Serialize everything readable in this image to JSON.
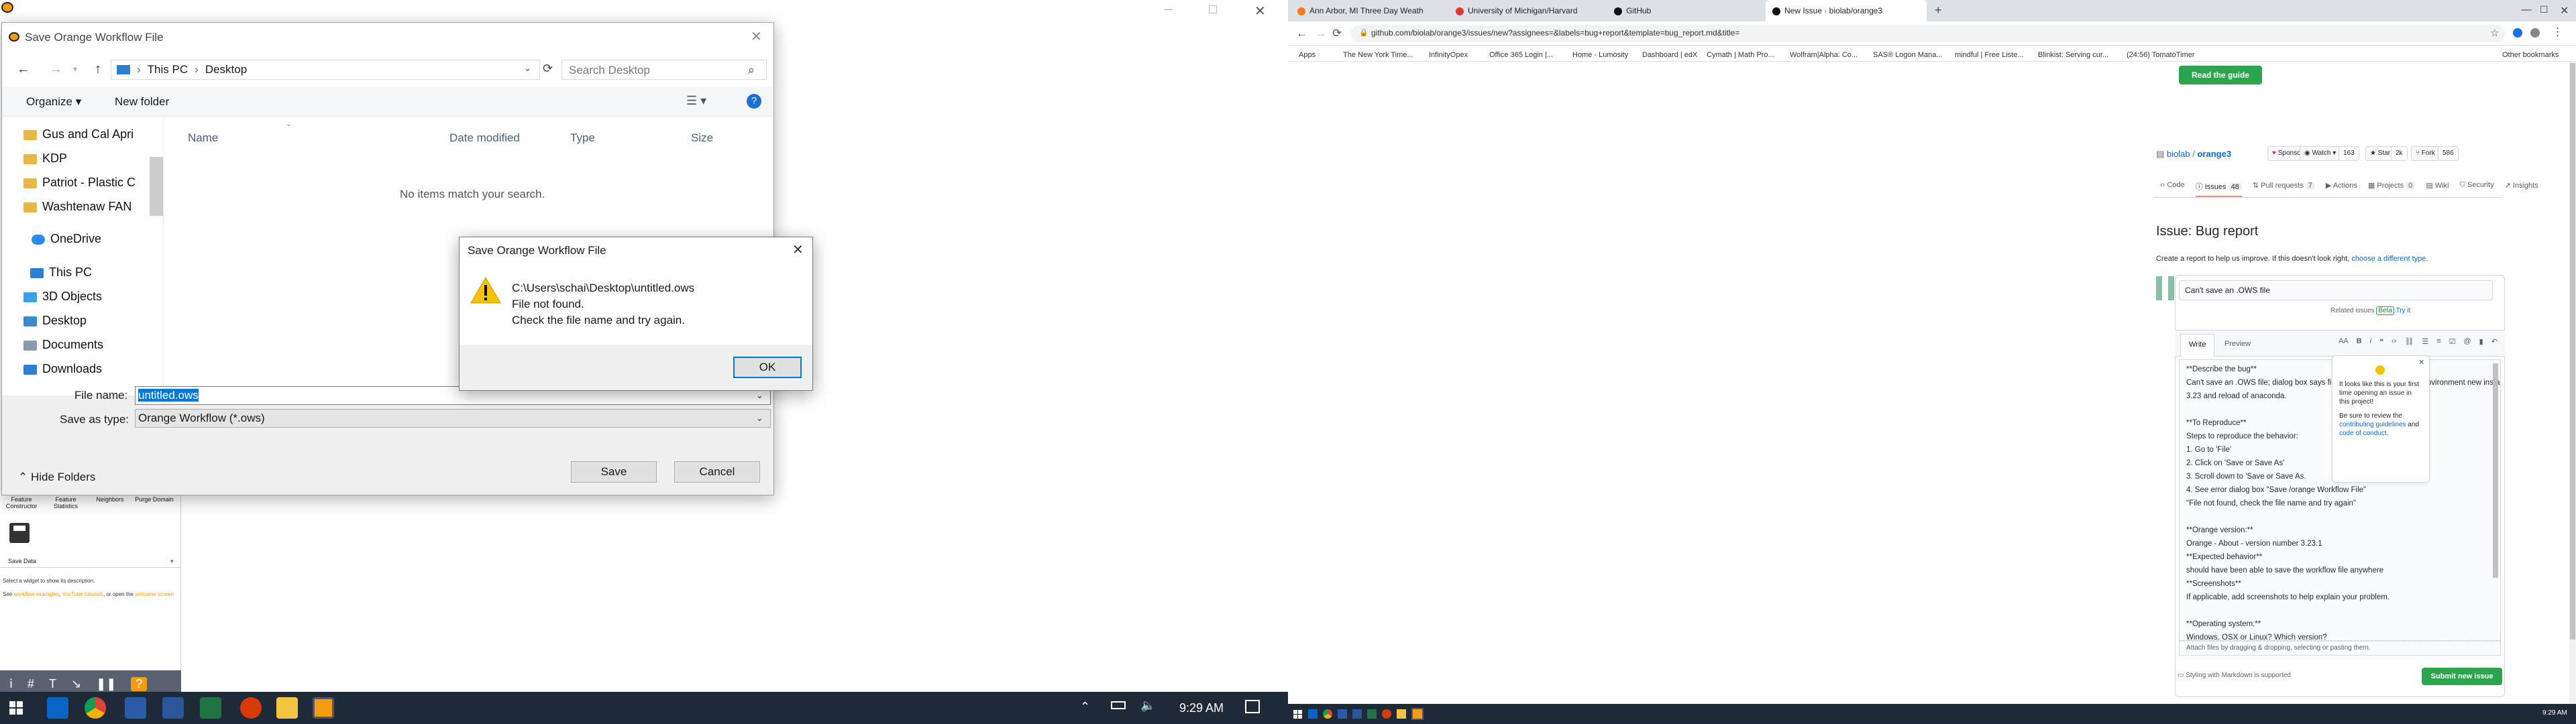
{
  "left": {
    "save_dialog": {
      "title": "Save Orange Workflow File",
      "breadcrumb": [
        "This PC",
        "Desktop"
      ],
      "search_placeholder": "Search Desktop",
      "organize": "Organize",
      "new_folder": "New folder",
      "columns": [
        "Name",
        "Date modified",
        "Type",
        "Size"
      ],
      "empty_text": "No items match your search.",
      "tree": [
        "Gus and Cal Apri",
        "KDP",
        "Patriot - Plastic C",
        "Washtenaw FAN",
        "OneDrive",
        "This PC",
        "3D Objects",
        "Desktop",
        "Documents",
        "Downloads"
      ],
      "file_name_label": "File name:",
      "file_name": "untitled.ows",
      "save_type_label": "Save as type:",
      "save_type": "Orange Workflow (*.ows)",
      "hide_folders": "Hide Folders",
      "save": "Save",
      "cancel": "Cancel"
    },
    "error_dialog": {
      "title": "Save Orange Workflow File",
      "line1": "C:\\Users\\schai\\Desktop\\untitled.ows",
      "line2": "File not found.",
      "line3": "Check the file name and try again.",
      "ok": "OK"
    },
    "orange": {
      "widgets": [
        "Feature Constructor",
        "Feature Statistics",
        "Neighbors",
        "Purge Domain"
      ],
      "save_data": "Save Data",
      "help1": "Select a widget to show its description.",
      "help2a": "See",
      "help2b": "workflow examples",
      "help2c": "YouTube tutorials",
      "help2d": "or open the",
      "help2e": "welcome screen"
    },
    "taskbar": {
      "time": "9:29 AM"
    }
  },
  "right": {
    "tabs": [
      "Ann Arbor, MI Three Day Weath",
      "University of Michigan/Harvard",
      "GitHub",
      "New Issue · biolab/orange3"
    ],
    "url": "github.com/biolab/orange3/issues/new?assignees=&labels=bug+report&template=bug_report.md&title=",
    "bookmarks": [
      "Apps",
      "The New York Time...",
      "InfinityOpex",
      "Office 365 Login |...",
      "Home - Lumosity",
      "Dashboard | edX",
      "Cymath | Math Pro...",
      "Wolfram|Alpha: Co...",
      "SAS® Logon Mana...",
      "mindful | Free Liste...",
      "Blinkist: Serving cur...",
      "(24:56) TomatoTimer",
      "Other bookmarks"
    ],
    "read_guide": "Read the guide",
    "org": "biolab",
    "repo": "orange3",
    "sponsor": "Sponsor",
    "watch": "Watch",
    "watch_count": "163",
    "star": "Star",
    "star_count": "2k",
    "fork": "Fork",
    "fork_count": "586",
    "nav": [
      "Code",
      "Issues",
      "Pull requests",
      "Actions",
      "Projects",
      "Wiki",
      "Security",
      "Insights"
    ],
    "nav_counts": {
      "issues": "48",
      "pulls": "7",
      "projects": "0"
    },
    "issue_heading": "Issue: Bug report",
    "issue_sub": "Create a report to help us improve. If this doesn't look right,",
    "issue_sub_link": "choose a different type.",
    "title_value": "Can't save an .OWS file",
    "related": "Related issues",
    "beta": "Beta",
    "try": "Try it",
    "write": "Write",
    "preview": "Preview",
    "body_lines": [
      "**Describe the bug**",
      "Can't save an .OWS file; dialog box says file not found? Windows-10 environment new instance of",
      "3.23 and reload of anaconda.",
      "",
      "**To Reproduce**",
      "Steps to reproduce the behavior:",
      "1. Go to 'File'",
      "2. Click on 'Save or Save As'",
      "3. Scroll down to 'Save or Save As.",
      "4. See error dialog box \"Save /orange Workflow File\"",
      "\"File not found, check the file name and try again\"",
      "",
      "**Orange version:**",
      "Orange - About - version number 3.23.1",
      "**Expected behavior**",
      "should have been able to save the workflow file anywhere",
      "**Screenshots**",
      "If applicable, add screenshots to help explain your problem.",
      "",
      "**Operating system:**",
      "Windows, OSX or Linux? Which version?"
    ],
    "attach": "Attach files by dragging & dropping, selecting or pasting them.",
    "markdown": "Styling with Markdown is supported",
    "submit": "Submit new issue",
    "tip_text": "It looks like this is your first time opening an issue in this project!",
    "tip_review": "Be sure to review the",
    "tip_link1": "contributing guidelines",
    "tip_and": "and",
    "tip_link2": "code of conduct",
    "time": "9:29 AM"
  },
  "colors": {
    "orange_accent": "#f39c12",
    "gh_green": "#2da44e",
    "gh_link": "#0969da",
    "taskbar": "#1f2a38"
  }
}
